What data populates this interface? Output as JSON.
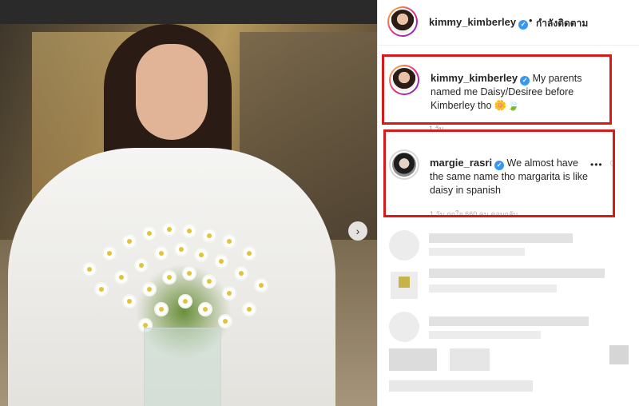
{
  "post": {
    "next_arrow": "›"
  },
  "header": {
    "username": "kimmy_kimberley",
    "separator": "•",
    "follow_status": "กำลังติดตาม",
    "verified_icon": "✓"
  },
  "comments": [
    {
      "username": "kimmy_kimberley",
      "verified_icon": "✓",
      "text": "My parents named me Daisy/Desiree before Kimberley tho 🌼🍃",
      "meta": "1 วัน"
    },
    {
      "username": "margie_rasri",
      "verified_icon": "✓",
      "text": "We almost have the same name tho margarita is like daisy in spanish",
      "more": "•••",
      "like_icon": "♡",
      "meta": "1 วัน   ถูกใจ 660 คน   ตอบกลับ"
    }
  ]
}
